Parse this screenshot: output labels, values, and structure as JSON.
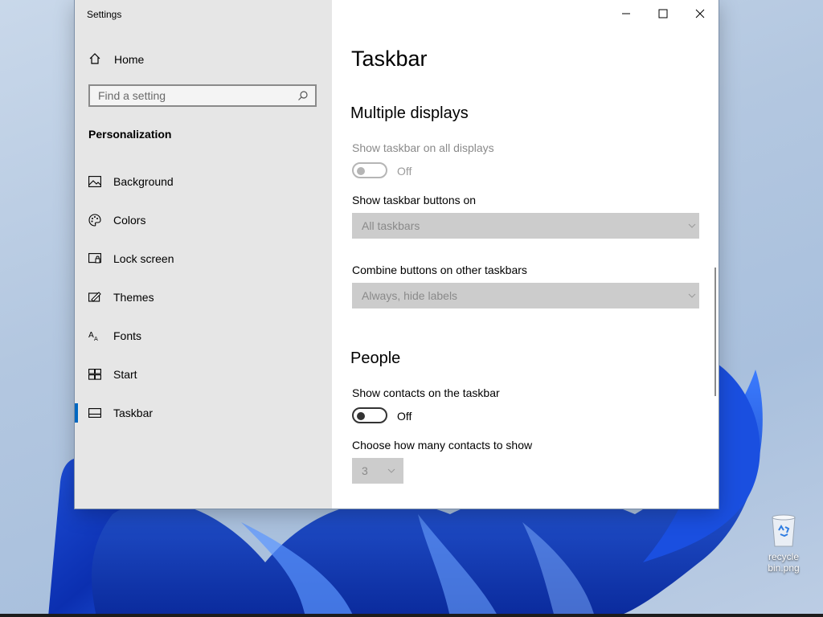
{
  "window": {
    "title": "Settings"
  },
  "sidebar": {
    "home_label": "Home",
    "search_placeholder": "Find a setting",
    "section_title": "Personalization",
    "items": [
      {
        "label": "Background",
        "icon": "picture-icon"
      },
      {
        "label": "Colors",
        "icon": "palette-icon"
      },
      {
        "label": "Lock screen",
        "icon": "lock-screen-icon"
      },
      {
        "label": "Themes",
        "icon": "themes-icon"
      },
      {
        "label": "Fonts",
        "icon": "fonts-icon"
      },
      {
        "label": "Start",
        "icon": "start-icon"
      },
      {
        "label": "Taskbar",
        "icon": "taskbar-icon",
        "active": true
      }
    ]
  },
  "content": {
    "page_title": "Taskbar",
    "multiple_displays": {
      "heading": "Multiple displays",
      "show_all_label": "Show taskbar on all displays",
      "show_all_state": "Off",
      "buttons_on_label": "Show taskbar buttons on",
      "buttons_on_value": "All taskbars",
      "combine_label": "Combine buttons on other taskbars",
      "combine_value": "Always, hide labels"
    },
    "people": {
      "heading": "People",
      "contacts_label": "Show contacts on the taskbar",
      "contacts_state": "Off",
      "count_label": "Choose how many contacts to show",
      "count_value": "3"
    }
  },
  "desktop": {
    "recycle_bin_label": "recycle bin.png"
  },
  "colors": {
    "accent": "#0067c0",
    "sidebar_bg": "#e6e6e6",
    "dropdown_disabled_bg": "#cccccc"
  }
}
